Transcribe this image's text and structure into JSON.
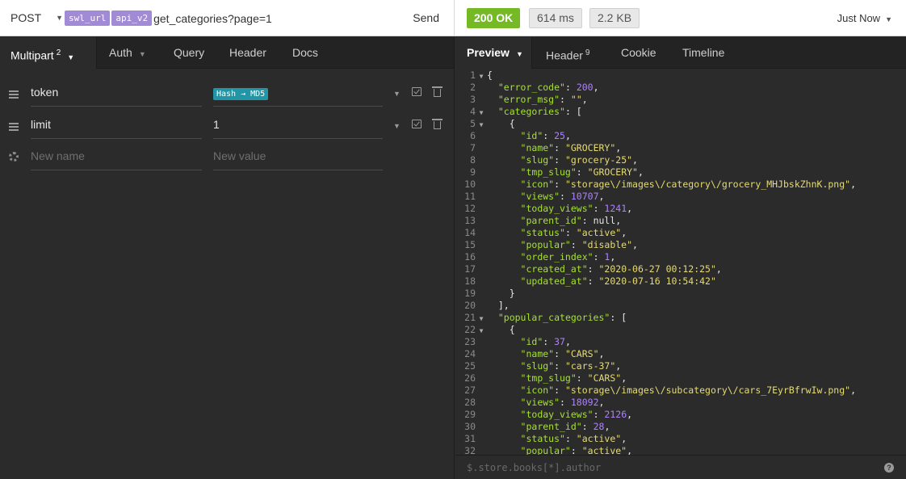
{
  "request": {
    "method": "POST",
    "url_tags": [
      "swl_url",
      "api_v2"
    ],
    "url_path": "get_categories?page=1",
    "send_label": "Send"
  },
  "response_meta": {
    "status": "200 OK",
    "time": "614 ms",
    "size": "2.2 KB",
    "when": "Just Now",
    "status_color": "#75ba24"
  },
  "left_tabs": {
    "multipart": "Multipart",
    "multipart_count": "2",
    "auth": "Auth",
    "query": "Query",
    "header": "Header",
    "docs": "Docs"
  },
  "params": [
    {
      "name": "token",
      "value_tag": "Hash → MD5"
    },
    {
      "name": "limit",
      "value": "1"
    }
  ],
  "new_param": {
    "name_placeholder": "New name",
    "value_placeholder": "New value"
  },
  "right_tabs": {
    "preview": "Preview",
    "header": "Header",
    "header_count": "9",
    "cookie": "Cookie",
    "timeline": "Timeline"
  },
  "filter_placeholder": "$.store.books[*].author",
  "json_lines": [
    {
      "n": "1",
      "fold": true,
      "indent": 0,
      "parts": [
        [
          "p",
          "{"
        ]
      ]
    },
    {
      "n": "2",
      "indent": 1,
      "parts": [
        [
          "k",
          "\"error_code\""
        ],
        [
          "p",
          ": "
        ],
        [
          "n",
          "200"
        ],
        [
          "p",
          ","
        ]
      ]
    },
    {
      "n": "3",
      "indent": 1,
      "parts": [
        [
          "k",
          "\"error_msg\""
        ],
        [
          "p",
          ": "
        ],
        [
          "s",
          "\"\""
        ],
        [
          "p",
          ","
        ]
      ]
    },
    {
      "n": "4",
      "fold": true,
      "indent": 1,
      "parts": [
        [
          "k",
          "\"categories\""
        ],
        [
          "p",
          ": ["
        ]
      ]
    },
    {
      "n": "5",
      "fold": true,
      "indent": 2,
      "parts": [
        [
          "p",
          "{"
        ]
      ]
    },
    {
      "n": "6",
      "indent": 3,
      "parts": [
        [
          "k",
          "\"id\""
        ],
        [
          "p",
          ": "
        ],
        [
          "n",
          "25"
        ],
        [
          "p",
          ","
        ]
      ]
    },
    {
      "n": "7",
      "indent": 3,
      "parts": [
        [
          "k",
          "\"name\""
        ],
        [
          "p",
          ": "
        ],
        [
          "s",
          "\"GROCERY\""
        ],
        [
          "p",
          ","
        ]
      ]
    },
    {
      "n": "8",
      "indent": 3,
      "parts": [
        [
          "k",
          "\"slug\""
        ],
        [
          "p",
          ": "
        ],
        [
          "s",
          "\"grocery-25\""
        ],
        [
          "p",
          ","
        ]
      ]
    },
    {
      "n": "9",
      "indent": 3,
      "parts": [
        [
          "k",
          "\"tmp_slug\""
        ],
        [
          "p",
          ": "
        ],
        [
          "s",
          "\"GROCERY\""
        ],
        [
          "p",
          ","
        ]
      ]
    },
    {
      "n": "10",
      "indent": 3,
      "parts": [
        [
          "k",
          "\"icon\""
        ],
        [
          "p",
          ": "
        ],
        [
          "s",
          "\"storage\\/images\\/category\\/grocery_MHJbskZhnK.png\""
        ],
        [
          "p",
          ","
        ]
      ]
    },
    {
      "n": "11",
      "indent": 3,
      "parts": [
        [
          "k",
          "\"views\""
        ],
        [
          "p",
          ": "
        ],
        [
          "n",
          "10707"
        ],
        [
          "p",
          ","
        ]
      ]
    },
    {
      "n": "12",
      "indent": 3,
      "parts": [
        [
          "k",
          "\"today_views\""
        ],
        [
          "p",
          ": "
        ],
        [
          "n",
          "1241"
        ],
        [
          "p",
          ","
        ]
      ]
    },
    {
      "n": "13",
      "indent": 3,
      "parts": [
        [
          "k",
          "\"parent_id\""
        ],
        [
          "p",
          ": "
        ],
        [
          "p",
          "null"
        ],
        [
          "p",
          ","
        ]
      ]
    },
    {
      "n": "14",
      "indent": 3,
      "parts": [
        [
          "k",
          "\"status\""
        ],
        [
          "p",
          ": "
        ],
        [
          "s",
          "\"active\""
        ],
        [
          "p",
          ","
        ]
      ]
    },
    {
      "n": "15",
      "indent": 3,
      "parts": [
        [
          "k",
          "\"popular\""
        ],
        [
          "p",
          ": "
        ],
        [
          "s",
          "\"disable\""
        ],
        [
          "p",
          ","
        ]
      ]
    },
    {
      "n": "16",
      "indent": 3,
      "parts": [
        [
          "k",
          "\"order_index\""
        ],
        [
          "p",
          ": "
        ],
        [
          "n",
          "1"
        ],
        [
          "p",
          ","
        ]
      ]
    },
    {
      "n": "17",
      "indent": 3,
      "parts": [
        [
          "k",
          "\"created_at\""
        ],
        [
          "p",
          ": "
        ],
        [
          "s",
          "\"2020-06-27 00:12:25\""
        ],
        [
          "p",
          ","
        ]
      ]
    },
    {
      "n": "18",
      "indent": 3,
      "parts": [
        [
          "k",
          "\"updated_at\""
        ],
        [
          "p",
          ": "
        ],
        [
          "s",
          "\"2020-07-16 10:54:42\""
        ]
      ]
    },
    {
      "n": "19",
      "indent": 2,
      "parts": [
        [
          "p",
          "}"
        ]
      ]
    },
    {
      "n": "20",
      "indent": 1,
      "parts": [
        [
          "p",
          "],"
        ]
      ]
    },
    {
      "n": "21",
      "fold": true,
      "indent": 1,
      "parts": [
        [
          "k",
          "\"popular_categories\""
        ],
        [
          "p",
          ": ["
        ]
      ]
    },
    {
      "n": "22",
      "fold": true,
      "indent": 2,
      "parts": [
        [
          "p",
          "{"
        ]
      ]
    },
    {
      "n": "23",
      "indent": 3,
      "parts": [
        [
          "k",
          "\"id\""
        ],
        [
          "p",
          ": "
        ],
        [
          "n",
          "37"
        ],
        [
          "p",
          ","
        ]
      ]
    },
    {
      "n": "24",
      "indent": 3,
      "parts": [
        [
          "k",
          "\"name\""
        ],
        [
          "p",
          ": "
        ],
        [
          "s",
          "\"CARS\""
        ],
        [
          "p",
          ","
        ]
      ]
    },
    {
      "n": "25",
      "indent": 3,
      "parts": [
        [
          "k",
          "\"slug\""
        ],
        [
          "p",
          ": "
        ],
        [
          "s",
          "\"cars-37\""
        ],
        [
          "p",
          ","
        ]
      ]
    },
    {
      "n": "26",
      "indent": 3,
      "parts": [
        [
          "k",
          "\"tmp_slug\""
        ],
        [
          "p",
          ": "
        ],
        [
          "s",
          "\"CARS\""
        ],
        [
          "p",
          ","
        ]
      ]
    },
    {
      "n": "27",
      "indent": 3,
      "parts": [
        [
          "k",
          "\"icon\""
        ],
        [
          "p",
          ": "
        ],
        [
          "s",
          "\"storage\\/images\\/subcategory\\/cars_7EyrBfrwIw.png\""
        ],
        [
          "p",
          ","
        ]
      ]
    },
    {
      "n": "28",
      "indent": 3,
      "parts": [
        [
          "k",
          "\"views\""
        ],
        [
          "p",
          ": "
        ],
        [
          "n",
          "18092"
        ],
        [
          "p",
          ","
        ]
      ]
    },
    {
      "n": "29",
      "indent": 3,
      "parts": [
        [
          "k",
          "\"today_views\""
        ],
        [
          "p",
          ": "
        ],
        [
          "n",
          "2126"
        ],
        [
          "p",
          ","
        ]
      ]
    },
    {
      "n": "30",
      "indent": 3,
      "parts": [
        [
          "k",
          "\"parent_id\""
        ],
        [
          "p",
          ": "
        ],
        [
          "n",
          "28"
        ],
        [
          "p",
          ","
        ]
      ]
    },
    {
      "n": "31",
      "indent": 3,
      "parts": [
        [
          "k",
          "\"status\""
        ],
        [
          "p",
          ": "
        ],
        [
          "s",
          "\"active\""
        ],
        [
          "p",
          ","
        ]
      ]
    },
    {
      "n": "32",
      "indent": 3,
      "parts": [
        [
          "k",
          "\"popular\""
        ],
        [
          "p",
          ": "
        ],
        [
          "s",
          "\"active\""
        ],
        [
          "p",
          ","
        ]
      ]
    }
  ]
}
